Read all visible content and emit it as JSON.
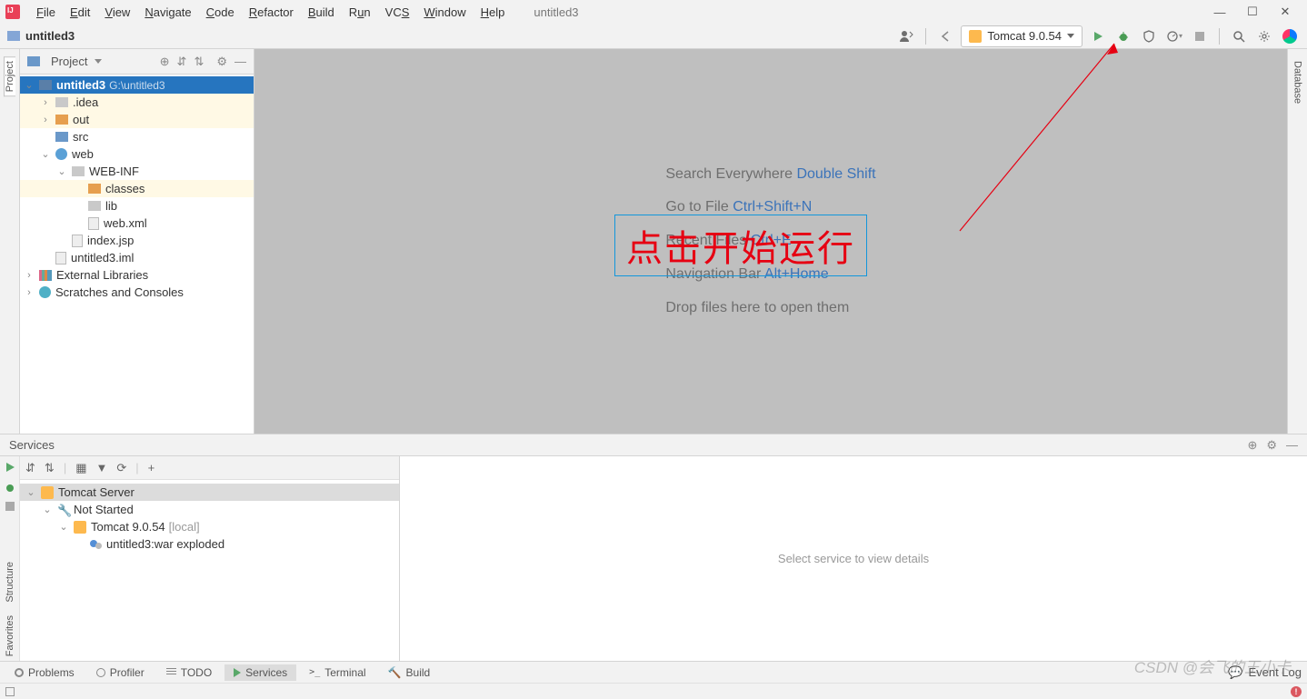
{
  "menu": {
    "file": "File",
    "edit": "Edit",
    "view": "View",
    "navigate": "Navigate",
    "code": "Code",
    "refactor": "Refactor",
    "build": "Build",
    "run": "Run",
    "vcs": "VCS",
    "window": "Window",
    "help": "Help"
  },
  "editor_title": "untitled3",
  "navbar": {
    "project": "untitled3",
    "run_config": "Tomcat 9.0.54"
  },
  "project_panel": {
    "title": "Project",
    "root": "untitled3",
    "root_path": "G:\\untitled3",
    "idea": ".idea",
    "out": "out",
    "src": "src",
    "web": "web",
    "webinf": "WEB-INF",
    "classes": "classes",
    "lib": "lib",
    "webxml": "web.xml",
    "indexjsp": "index.jsp",
    "iml": "untitled3.iml",
    "ext": "External Libraries",
    "scratch": "Scratches and Consoles"
  },
  "welcome": {
    "search": "Search Everywhere ",
    "search_sc": "Double Shift",
    "goto": "Go to File ",
    "goto_sc": "Ctrl+Shift+N",
    "recent": "Recent Files ",
    "recent_sc": "Ctrl+E",
    "nav": "Navigation Bar ",
    "nav_sc": "Alt+Home",
    "drop": "Drop files here to open them"
  },
  "annotation": "点击开始运行",
  "services": {
    "title": "Services",
    "tomcat_server": "Tomcat Server",
    "not_started": "Not Started",
    "tomcat": "Tomcat 9.0.54 ",
    "local": "[local]",
    "artifact": "untitled3:war exploded",
    "detail": "Select service to view details"
  },
  "tabs": {
    "problems": "Problems",
    "profiler": "Profiler",
    "todo": "TODO",
    "services": "Services",
    "terminal": "Terminal",
    "build": "Build",
    "event_log": "Event Log"
  },
  "gutters": {
    "project": "Project",
    "structure": "Structure",
    "favorites": "Favorites",
    "database": "Database"
  },
  "watermark": "CSDN @会飞的王小卡"
}
